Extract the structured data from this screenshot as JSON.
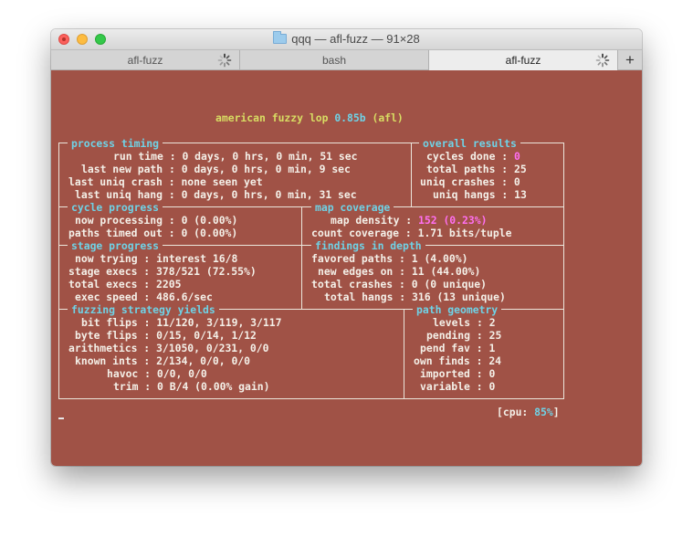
{
  "window": {
    "title": "qqq — afl-fuzz — 91×28",
    "folder_icon": "folder-icon"
  },
  "tabs": [
    {
      "label": "afl-fuzz",
      "active": false,
      "busy": true
    },
    {
      "label": "bash",
      "active": false,
      "busy": false
    },
    {
      "label": "afl-fuzz",
      "active": true,
      "busy": true
    }
  ],
  "new_tab_label": "+",
  "colors": {
    "terminal_bg": "#a05246",
    "text": "#f4f0e8",
    "cyan": "#6fd2e6",
    "yellow": "#d8dd63",
    "magenta": "#ff6ff1"
  },
  "banner": {
    "app": "american fuzzy lop",
    "version": "0.85b",
    "target": "(afl)"
  },
  "sections": {
    "process_timing": "process timing",
    "overall_results": "overall results",
    "cycle_progress": "cycle progress",
    "map_coverage": "map coverage",
    "stage_progress": "stage progress",
    "findings_in_depth": "findings in depth",
    "fuzzing_strategy_yields": "fuzzing strategy yields",
    "path_geometry": "path geometry"
  },
  "process_timing": {
    "run_time": {
      "label": "run time",
      "value": "0 days, 0 hrs, 0 min, 51 sec"
    },
    "last_new_path": {
      "label": "last new path",
      "value": "0 days, 0 hrs, 0 min, 9 sec"
    },
    "last_uniq_crash": {
      "label": "last uniq crash",
      "value": "none seen yet"
    },
    "last_uniq_hang": {
      "label": "last uniq hang",
      "value": "0 days, 0 hrs, 0 min, 31 sec"
    }
  },
  "overall_results": {
    "cycles_done": {
      "label": "cycles done",
      "value": "0"
    },
    "total_paths": {
      "label": "total paths",
      "value": "25"
    },
    "uniq_crashes": {
      "label": "uniq crashes",
      "value": "0"
    },
    "uniq_hangs": {
      "label": "uniq hangs",
      "value": "13"
    }
  },
  "cycle_progress": {
    "now_processing": {
      "label": "now processing",
      "value": "0 (0.00%)"
    },
    "paths_timed_out": {
      "label": "paths timed out",
      "value": "0 (0.00%)"
    }
  },
  "map_coverage": {
    "map_density": {
      "label": "map density",
      "value": "152 (0.23%)"
    },
    "count_coverage": {
      "label": "count coverage",
      "value": "1.71 bits/tuple"
    }
  },
  "stage_progress": {
    "now_trying": {
      "label": "now trying",
      "value": "interest 16/8"
    },
    "stage_execs": {
      "label": "stage execs",
      "value": "378/521 (72.55%)"
    },
    "total_execs": {
      "label": "total execs",
      "value": "2205"
    },
    "exec_speed": {
      "label": "exec speed",
      "value": "486.6/sec"
    }
  },
  "findings_in_depth": {
    "favored_paths": {
      "label": "favored paths",
      "value": "1 (4.00%)"
    },
    "new_edges_on": {
      "label": "new edges on",
      "value": "11 (44.00%)"
    },
    "total_crashes": {
      "label": "total crashes",
      "value": "0 (0 unique)"
    },
    "total_hangs": {
      "label": "total hangs",
      "value": "316 (13 unique)"
    }
  },
  "fuzzing_strategy_yields": {
    "bit_flips": {
      "label": "bit flips",
      "value": "11/120, 3/119, 3/117"
    },
    "byte_flips": {
      "label": "byte flips",
      "value": "0/15, 0/14, 1/12"
    },
    "arithmetics": {
      "label": "arithmetics",
      "value": "3/1050, 0/231, 0/0"
    },
    "known_ints": {
      "label": "known ints",
      "value": "2/134, 0/0, 0/0"
    },
    "havoc": {
      "label": "havoc",
      "value": "0/0, 0/0"
    },
    "trim": {
      "label": "trim",
      "value": "0 B/4 (0.00% gain)"
    }
  },
  "path_geometry": {
    "levels": {
      "label": "levels",
      "value": "2"
    },
    "pending": {
      "label": "pending",
      "value": "25"
    },
    "pend_fav": {
      "label": "pend fav",
      "value": "1"
    },
    "own_finds": {
      "label": "own finds",
      "value": "24"
    },
    "imported": {
      "label": "imported",
      "value": "0"
    },
    "variable": {
      "label": "variable",
      "value": "0"
    }
  },
  "cpu": {
    "label": "cpu:",
    "value": "85%"
  }
}
